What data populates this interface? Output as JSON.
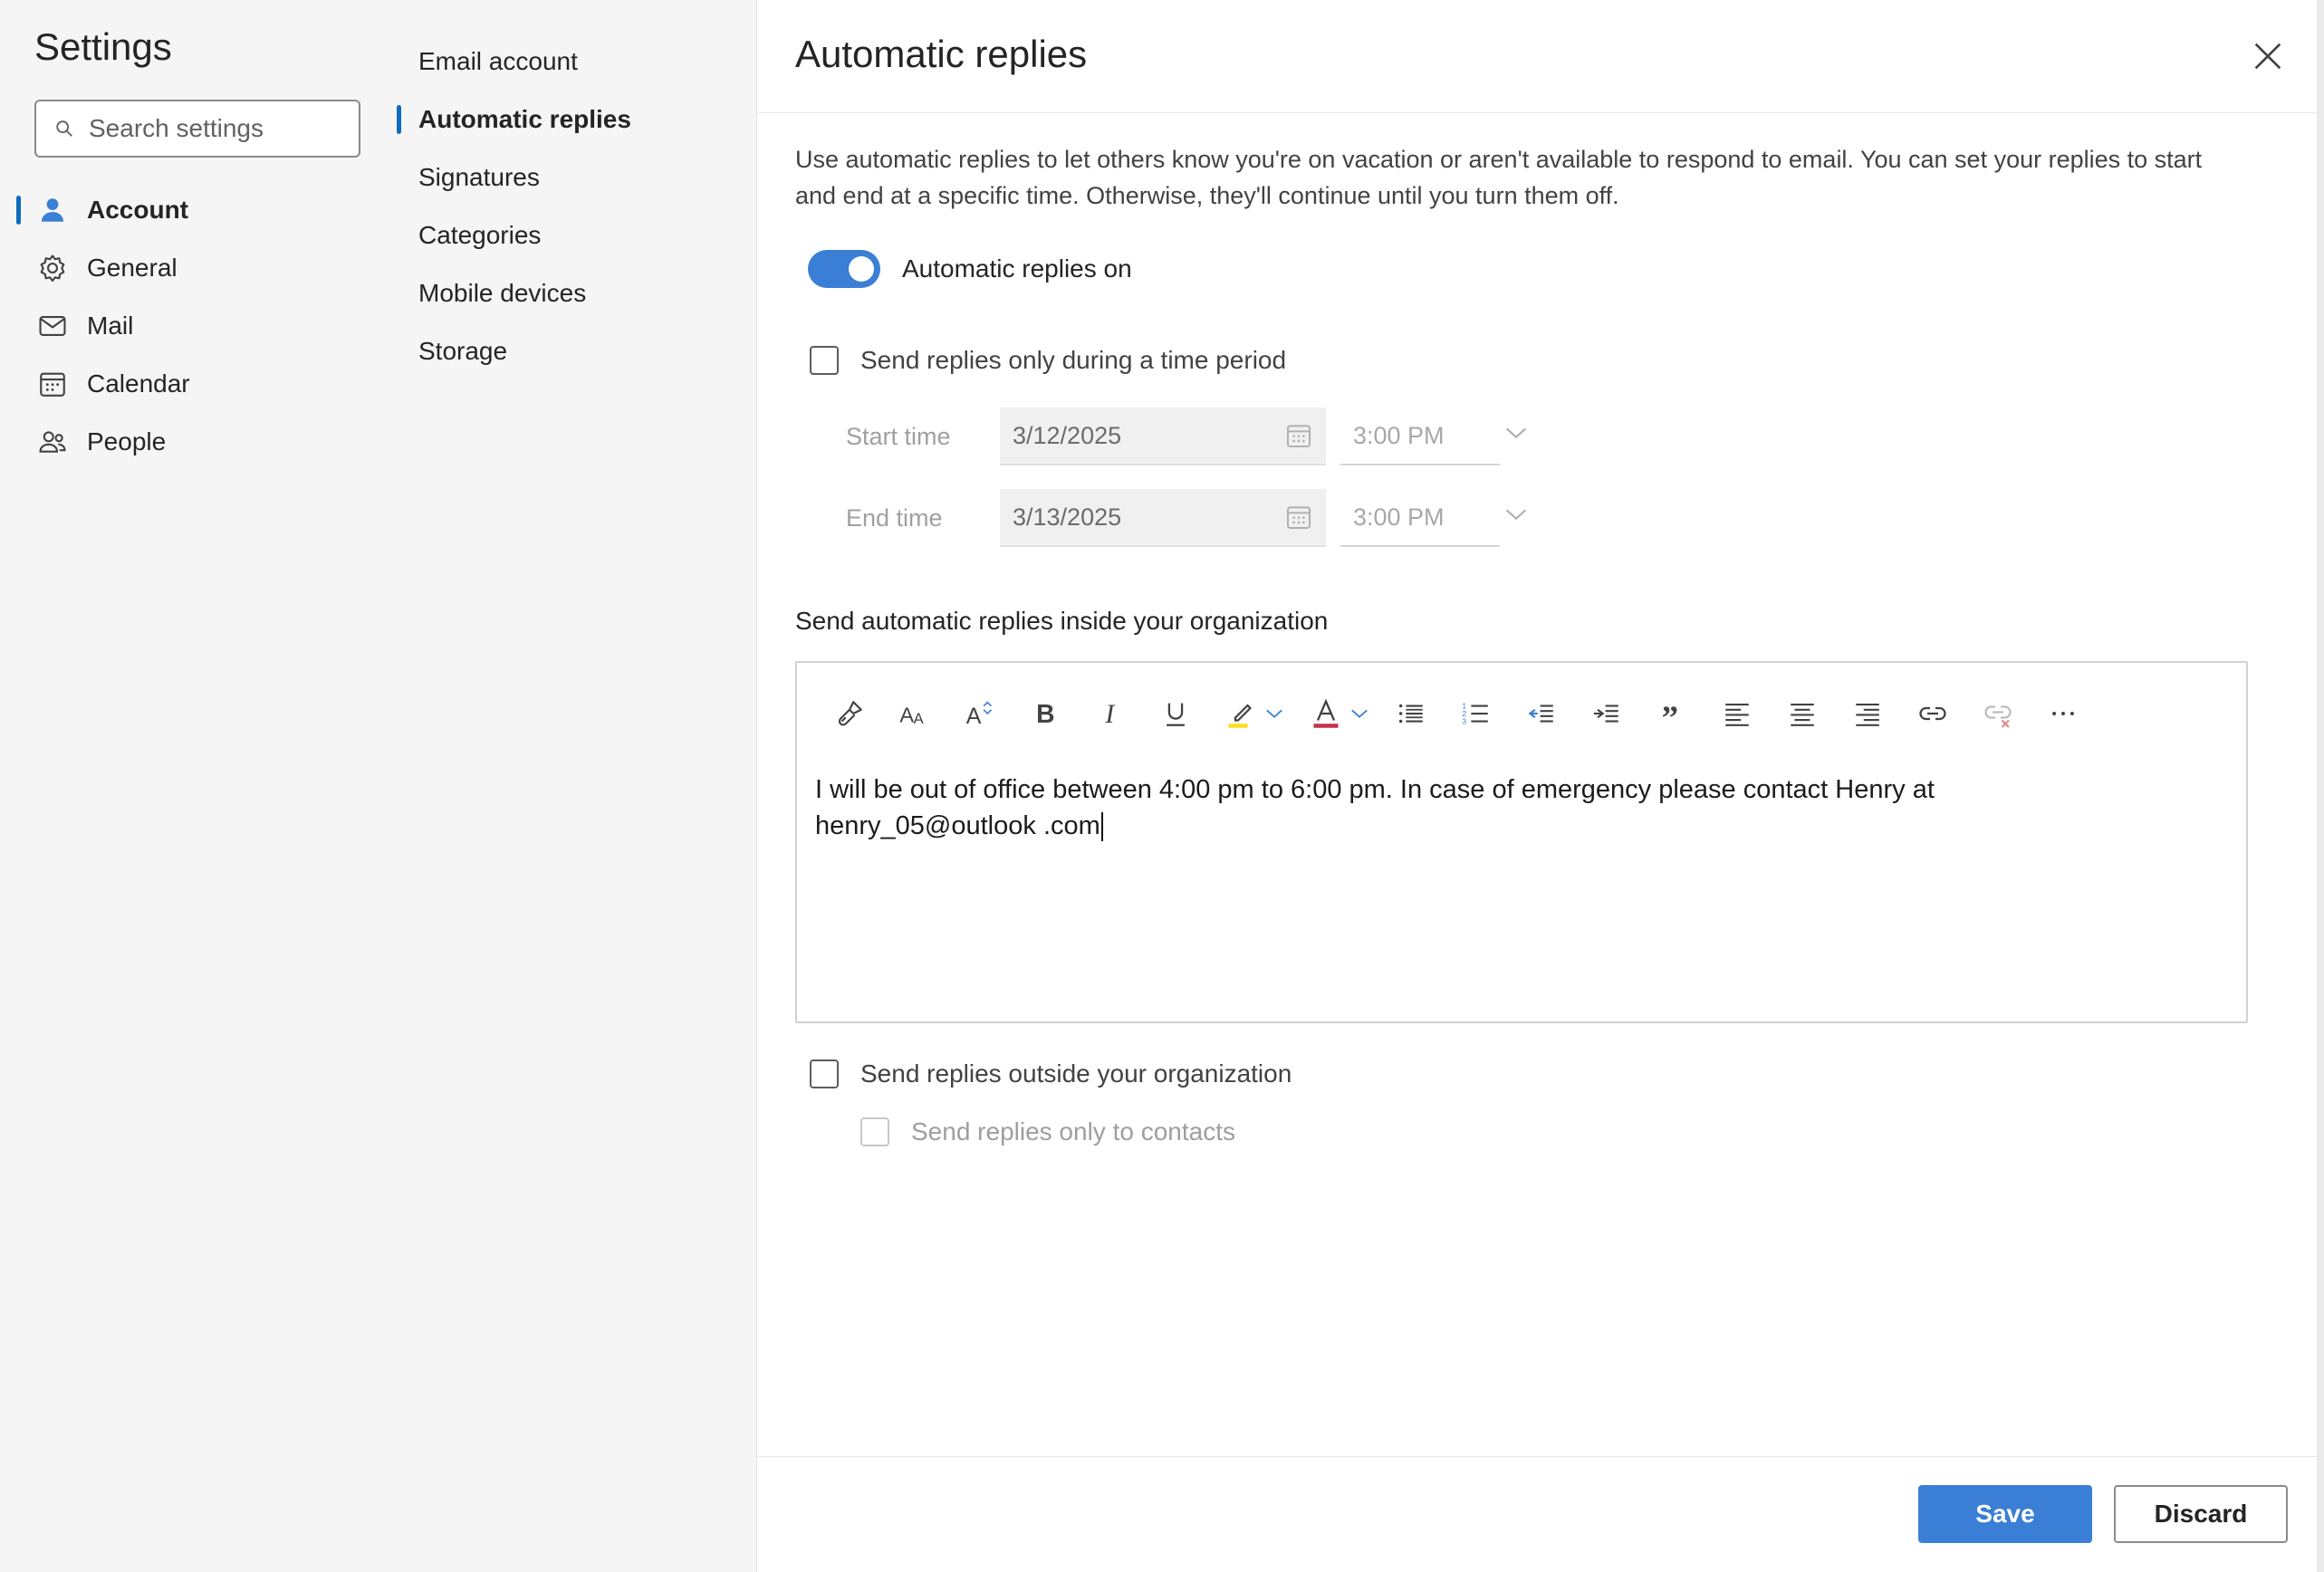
{
  "nav": {
    "title": "Settings",
    "search_placeholder": "Search settings",
    "items": [
      {
        "label": "Account",
        "icon": "person-icon",
        "active": true
      },
      {
        "label": "General",
        "icon": "gear-icon",
        "active": false
      },
      {
        "label": "Mail",
        "icon": "mail-icon",
        "active": false
      },
      {
        "label": "Calendar",
        "icon": "calendar-icon",
        "active": false
      },
      {
        "label": "People",
        "icon": "people-icon",
        "active": false
      }
    ]
  },
  "subnav": {
    "items": [
      {
        "label": "Email account",
        "active": false
      },
      {
        "label": "Automatic replies",
        "active": true
      },
      {
        "label": "Signatures",
        "active": false
      },
      {
        "label": "Categories",
        "active": false
      },
      {
        "label": "Mobile devices",
        "active": false
      },
      {
        "label": "Storage",
        "active": false
      }
    ]
  },
  "main": {
    "title": "Automatic replies",
    "description": "Use automatic replies to let others know you're on vacation or aren't available to respond to email. You can set your replies to start and end at a specific time. Otherwise, they'll continue until you turn them off.",
    "toggle": {
      "label": "Automatic replies on",
      "on": true
    },
    "time_period": {
      "label": "Send replies only during a time period",
      "checked": false
    },
    "start": {
      "label": "Start time",
      "date": "3/12/2025",
      "time": "3:00 PM"
    },
    "end": {
      "label": "End time",
      "date": "3/13/2025",
      "time": "3:00 PM"
    },
    "inside_label": "Send automatic replies inside your organization",
    "message_line1": "I will be out of office between 4:00 pm to 6:00 pm. In case of emergency please contact Henry at",
    "message_line2": "henry_05@outlook .com",
    "outside": {
      "label": "Send replies outside your organization",
      "checked": false
    },
    "contacts_only": {
      "label": "Send replies only to contacts",
      "checked": false,
      "disabled": true
    }
  },
  "footer": {
    "save_label": "Save",
    "discard_label": "Discard"
  },
  "colors": {
    "accent": "#0f6cbd",
    "button_blue": "#3a7fd5",
    "highlight_yellow": "#f7e11c",
    "font_red": "#c4314b"
  }
}
